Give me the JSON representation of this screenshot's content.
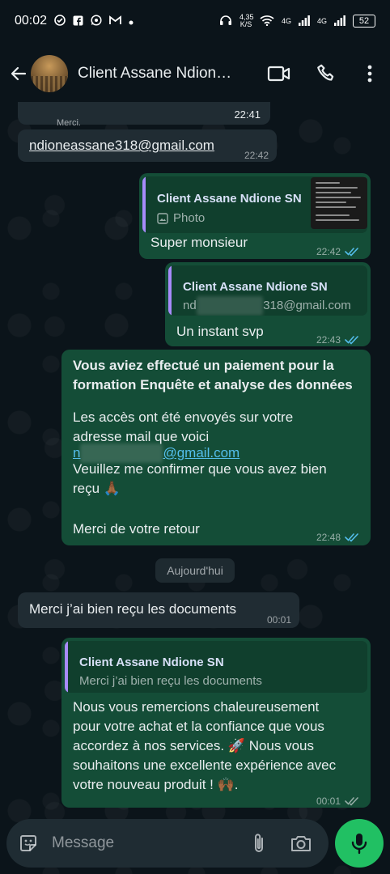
{
  "status_bar": {
    "time": "00:02",
    "net_speed_value": "4,35",
    "net_speed_unit": "K/S",
    "battery": "52",
    "signal_1": "4G",
    "signal_2": "4G"
  },
  "header": {
    "contact_name": "Client Assane Ndione SN"
  },
  "messages": [
    {
      "id": "m0",
      "direction": "incoming",
      "partial_text": "Merci.",
      "time": "22:41"
    },
    {
      "id": "m1",
      "direction": "incoming",
      "text": "ndioneassane318@gmail.com",
      "time": "22:42"
    },
    {
      "id": "m2",
      "direction": "outgoing",
      "quote_name": "Client Assane Ndione SN",
      "quote_text": "Photo",
      "text": "Super monsieur",
      "time": "22:42"
    },
    {
      "id": "m3",
      "direction": "outgoing",
      "quote_name": "Client Assane Ndione SN",
      "quote_text_start": "nd",
      "quote_text_end": "318@gmail.com",
      "text": "Un instant svp",
      "time": "22:43"
    },
    {
      "id": "m4",
      "direction": "outgoing",
      "title": "Vous aviez effectué un paiement pour la formation Enquête et analyse des données",
      "line1": "Les accès ont été envoyés sur votre adresse mail que voici",
      "email_start": "n",
      "email_end": "@gmail.com",
      "line2": "Veuillez me confirmer que vous avez bien reçu 🙏🏾",
      "line3": "Merci de votre retour",
      "time": "22:48"
    },
    {
      "id": "m5",
      "direction": "incoming",
      "text": "Merci j’ai bien reçu les documents",
      "time": "00:01"
    },
    {
      "id": "m6",
      "direction": "outgoing",
      "quote_name": "Client Assane Ndione SN",
      "quote_text": "Merci j’ai bien reçu les documents",
      "text": "Nous vous remercions chaleureusement pour votre achat et la confiance que vous accordez à nos services. 🚀 Nous vous souhaitons une excellente expérience avec votre nouveau produit ! 🙌🏾.",
      "time": "00:01"
    }
  ],
  "date_separator": "Aujourd'hui",
  "composer": {
    "placeholder": "Message"
  },
  "colors": {
    "background": "#0b141a",
    "incoming_bubble": "#202c33",
    "outgoing_bubble": "#144d37",
    "link": "#53bdeb",
    "read_ticks": "#53bdeb",
    "mic_button": "#21c063"
  },
  "icons": {
    "back": "arrow-left-icon",
    "video": "video-call-icon",
    "call": "phone-icon",
    "menu": "more-vertical-icon",
    "emoji": "sticker-icon",
    "attach": "paperclip-icon",
    "camera": "camera-icon",
    "mic": "mic-icon"
  }
}
